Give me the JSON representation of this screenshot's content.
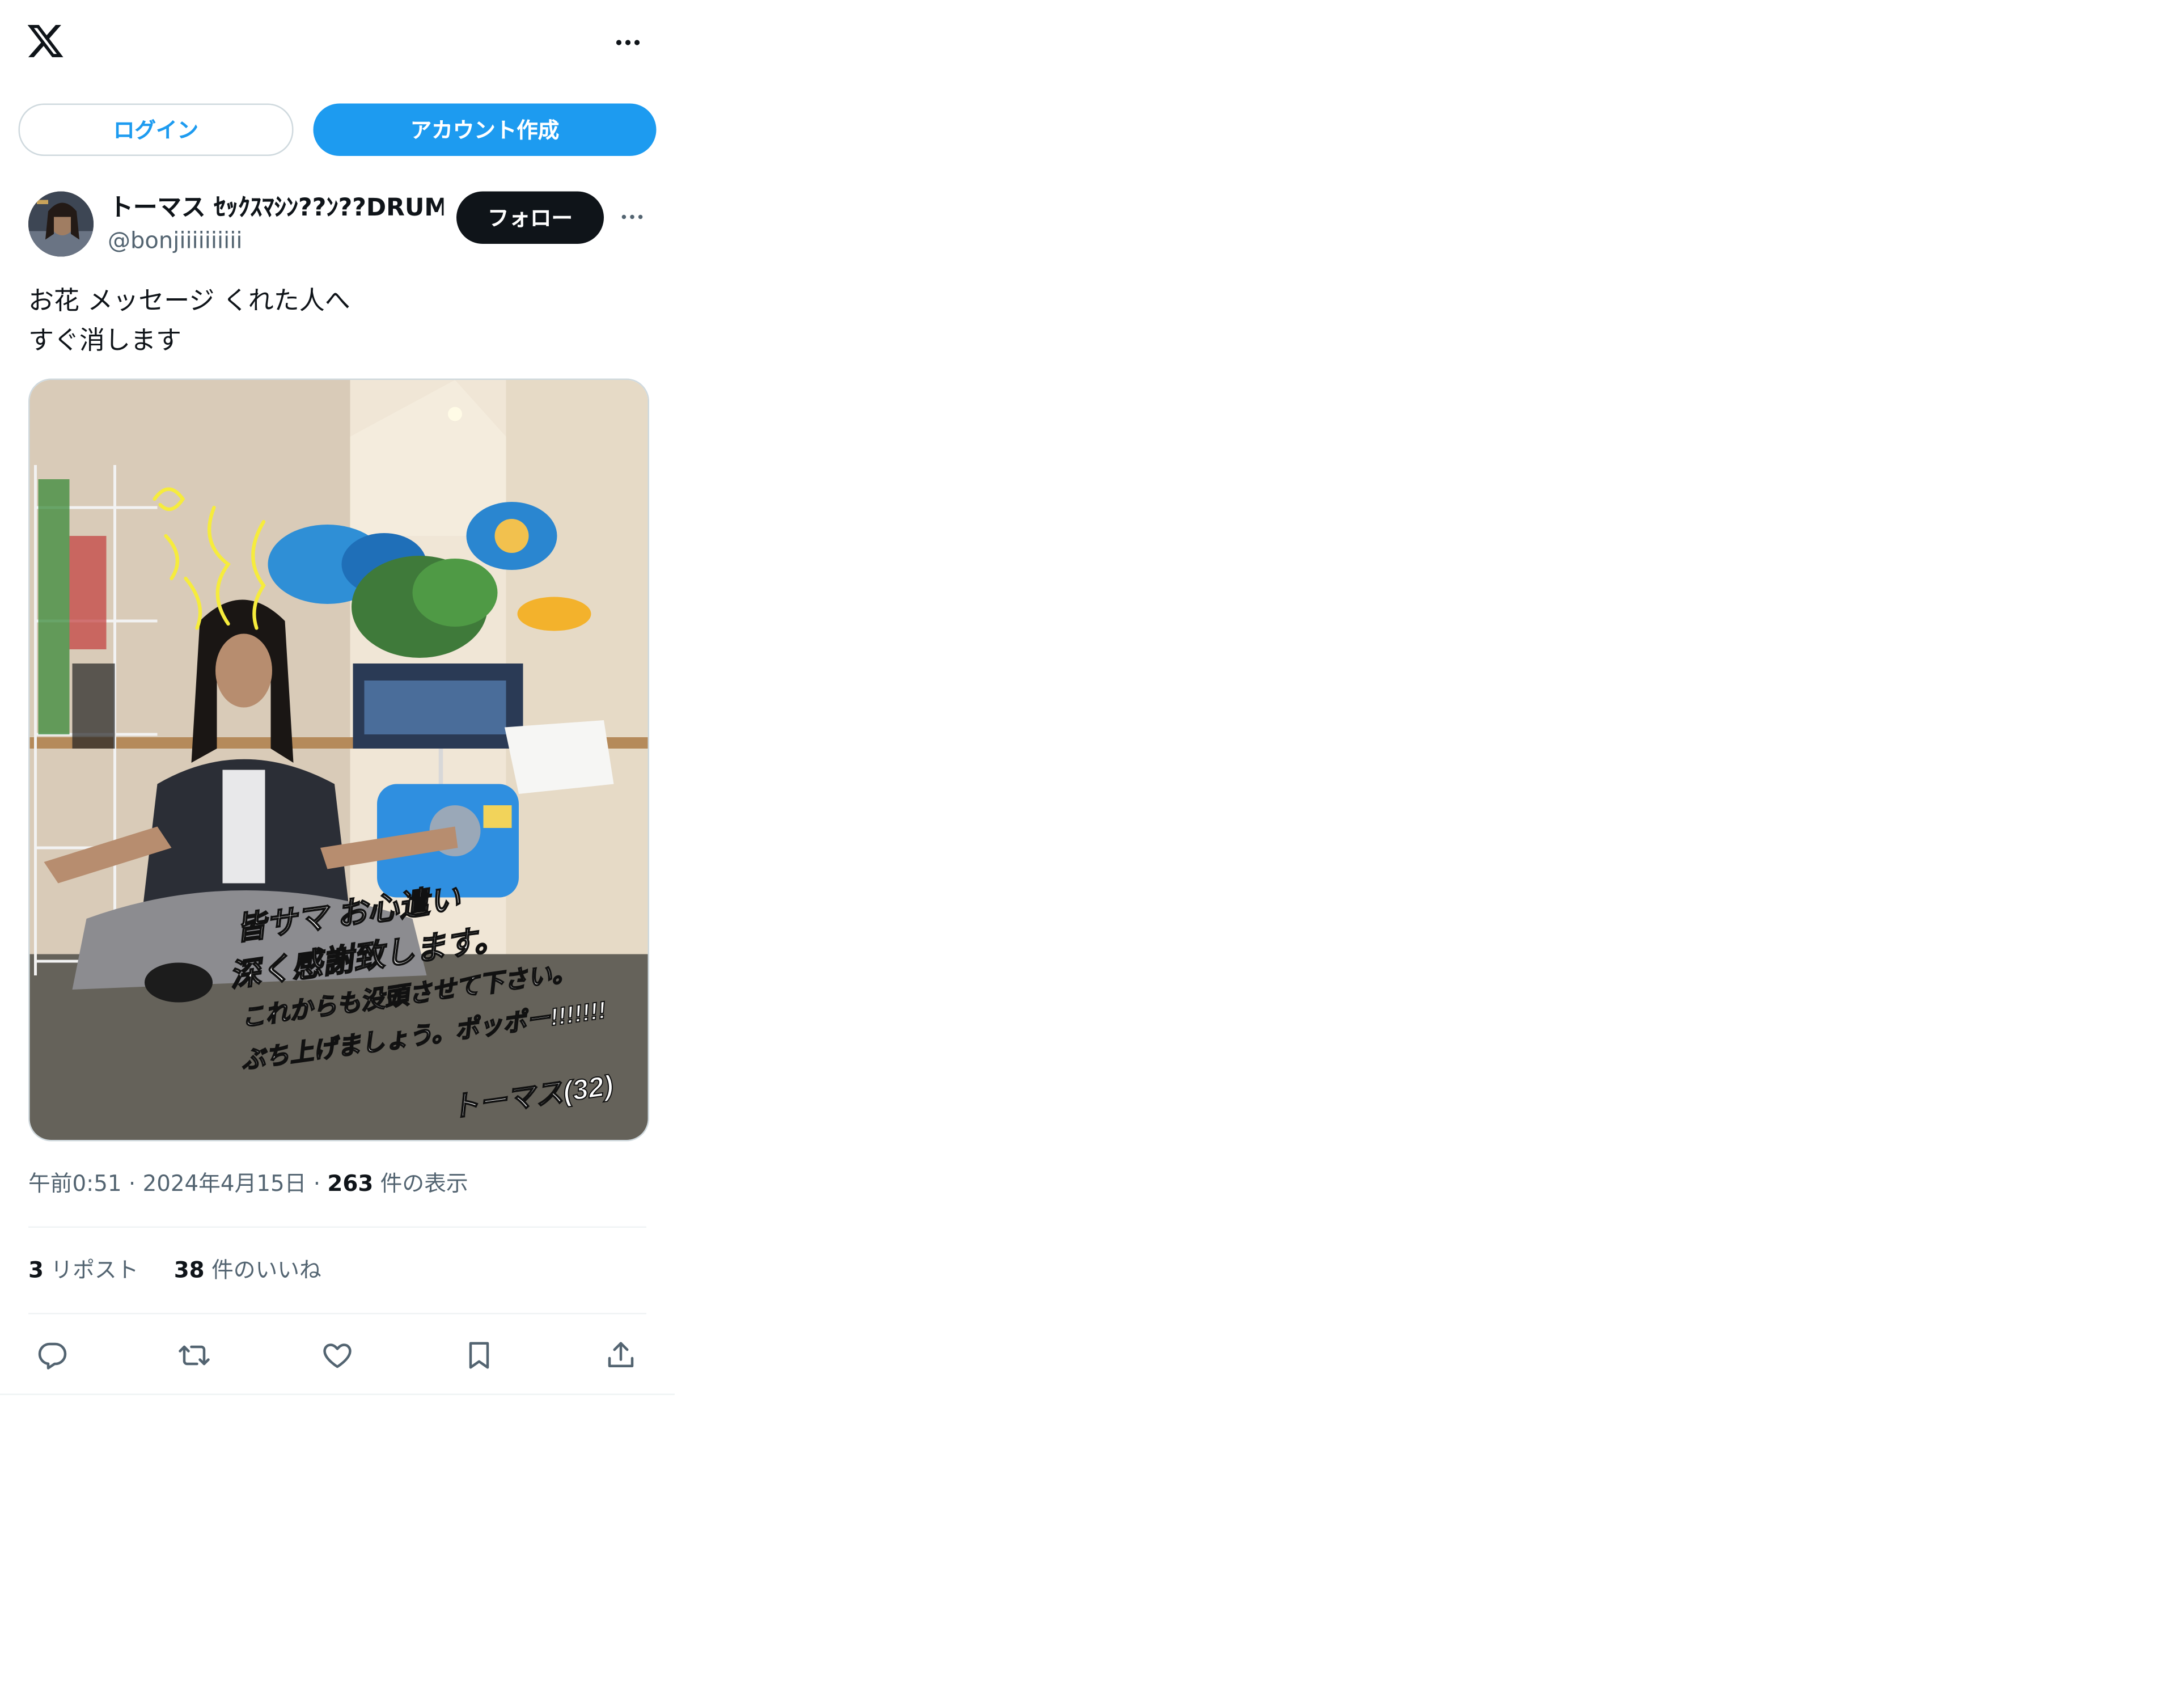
{
  "header": {
    "logo_icon": "x-logo-icon",
    "more_icon": "more-horizontal-icon"
  },
  "auth": {
    "login_label": "ログイン",
    "signup_label": "アカウント作成"
  },
  "post": {
    "author_name": "トーマス ｾｯｸｽﾏｼﾝ??ﾝ??DRUMMER",
    "author_handle": "@bonjiiiiiiiiii",
    "follow_label": "フォロー",
    "text_lines": [
      "お花 メッセージ くれた人へ",
      "すぐ消します"
    ],
    "image_caption_handwritten": [
      "皆サマ お心遣い",
      "深く感謝致します。",
      "これからも没頭させて下さい。",
      "ぶち上げましょう。ポッポー!!!!!!!",
      "トーマス(32)"
    ],
    "time": "午前0:51",
    "separator": "·",
    "date": "2024年4月15日",
    "views_count": "263",
    "views_label": "件の表示",
    "reposts_count": "3",
    "reposts_label": "リポスト",
    "likes_count": "38",
    "likes_label": "件のいいね"
  },
  "actions": [
    "reply-icon",
    "repost-icon",
    "like-icon",
    "bookmark-icon",
    "share-icon"
  ],
  "colors": {
    "accent": "#1d9bf0",
    "text": "#0f1419",
    "secondary": "#536471",
    "border": "#cfd9de"
  }
}
